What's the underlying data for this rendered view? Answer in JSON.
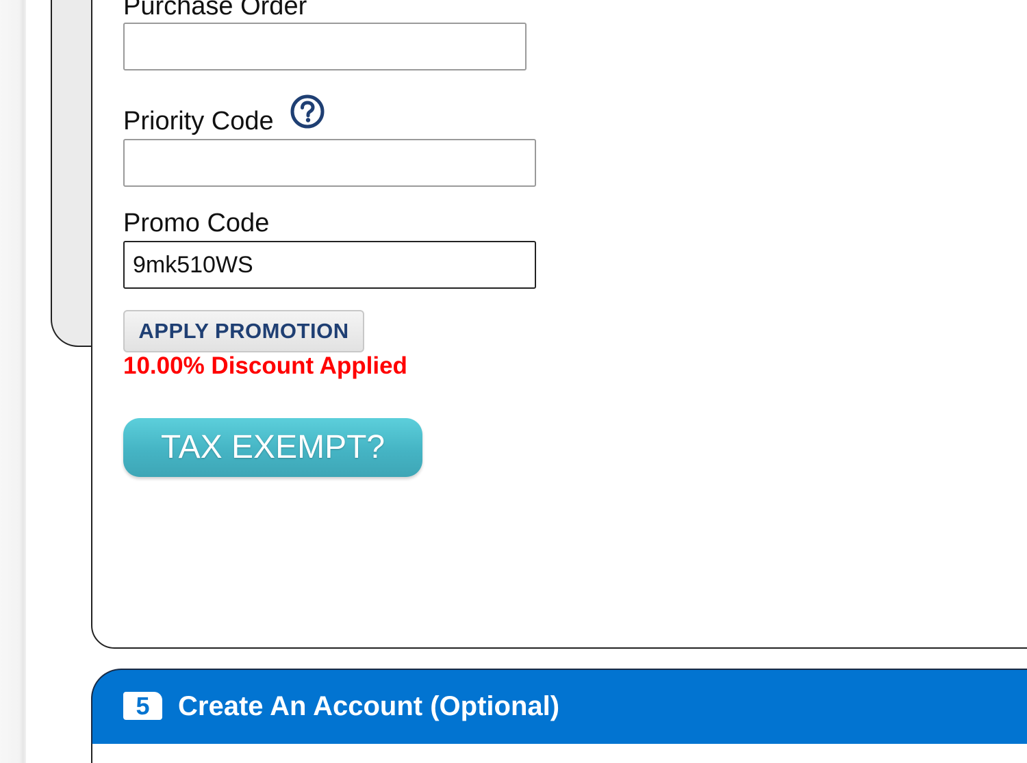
{
  "form": {
    "purchase_order": {
      "label": "Purchase Order",
      "value": ""
    },
    "priority_code": {
      "label": "Priority Code",
      "value": ""
    },
    "promo_code": {
      "label": "Promo Code",
      "value": "9mk510WS"
    },
    "apply_button_label": "APPLY PROMOTION",
    "discount_message": "10.00% Discount Applied",
    "tax_exempt_label": "TAX EXEMPT?"
  },
  "next_section": {
    "step_number": "5",
    "title": "Create An Account (Optional)"
  },
  "colors": {
    "section_header_bg": "#0274d1",
    "tax_button": "#45b4c4",
    "discount_text": "#ff0000",
    "apply_button_text": "#1f3f73",
    "help_icon": "#1f3f73"
  },
  "icons": {
    "help": "question-circle-icon"
  }
}
